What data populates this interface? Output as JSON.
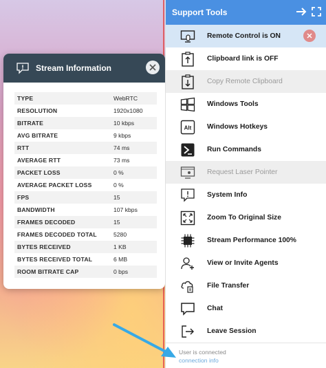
{
  "stream_popup": {
    "title": "Stream Information",
    "rows": [
      {
        "key": "TYPE",
        "value": "WebRTC"
      },
      {
        "key": "RESOLUTION",
        "value": "1920x1080"
      },
      {
        "key": "BITRATE",
        "value": "10 kbps"
      },
      {
        "key": "AVG BITRATE",
        "value": "9 kbps"
      },
      {
        "key": "RTT",
        "value": "74 ms"
      },
      {
        "key": "AVERAGE RTT",
        "value": "73 ms"
      },
      {
        "key": "PACKET LOSS",
        "value": "0 %"
      },
      {
        "key": "AVERAGE PACKET LOSS",
        "value": "0 %"
      },
      {
        "key": "FPS",
        "value": "15"
      },
      {
        "key": "BANDWIDTH",
        "value": "107 kbps"
      },
      {
        "key": "FRAMES DECODED",
        "value": "15"
      },
      {
        "key": "FRAMES DECODED TOTAL",
        "value": "5280"
      },
      {
        "key": "BYTES RECEIVED",
        "value": "1 KB"
      },
      {
        "key": "BYTES RECEIVED TOTAL",
        "value": "6 MB"
      },
      {
        "key": "ROOM BITRATE CAP",
        "value": "0 bps"
      }
    ]
  },
  "panel": {
    "title": "Support Tools",
    "items": [
      {
        "label": "Remote Control is ON",
        "icon": "remote-control-icon"
      },
      {
        "label": "Clipboard link is OFF",
        "icon": "clipboard-upload-icon"
      },
      {
        "label": "Copy Remote Clipboard",
        "icon": "clipboard-download-icon"
      },
      {
        "label": "Windows Tools",
        "icon": "windows-icon"
      },
      {
        "label": "Windows Hotkeys",
        "icon": "alt-key-icon"
      },
      {
        "label": "Run Commands",
        "icon": "terminal-icon"
      },
      {
        "label": "Request Laser Pointer",
        "icon": "laser-pointer-icon"
      },
      {
        "label": "System Info",
        "icon": "system-info-icon"
      },
      {
        "label": "Zoom To Original Size",
        "icon": "zoom-original-icon"
      },
      {
        "label": "Stream Performance 100%",
        "icon": "chip-icon"
      },
      {
        "label": "View or Invite Agents",
        "icon": "agents-icon"
      },
      {
        "label": "File Transfer",
        "icon": "file-transfer-icon"
      },
      {
        "label": "Chat",
        "icon": "chat-icon"
      },
      {
        "label": "Leave Session",
        "icon": "leave-session-icon"
      }
    ],
    "status_text": "User is connected",
    "status_link": "connection info"
  },
  "colors": {
    "panel_header": "#4a90e2",
    "popup_header": "#364856",
    "active_item": "#d6e6f6",
    "close_red": "#e08a8a",
    "annotation_arrow": "#37a9e6"
  }
}
